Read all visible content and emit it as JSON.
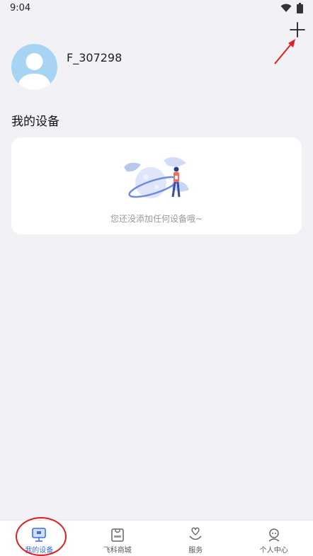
{
  "status_bar": {
    "time": "9:04"
  },
  "header": {
    "username": "F_307298",
    "add_icon": "plus-icon"
  },
  "devices": {
    "section_title": "我的设备",
    "empty_message": "您还没添加任何设备哦~"
  },
  "bottom_nav": {
    "items": [
      {
        "label": "我的设备",
        "icon": "monitor-icon",
        "active": true
      },
      {
        "label": "飞科商城",
        "icon": "shopping-bag-icon",
        "active": false
      },
      {
        "label": "服务",
        "icon": "heart-hand-icon",
        "active": false
      },
      {
        "label": "个人中心",
        "icon": "profile-icon",
        "active": false
      }
    ]
  },
  "colors": {
    "background": "#f2f1f6",
    "card": "#ffffff",
    "accent": "#3b6fe0",
    "avatar": "#a7d4f3",
    "annotation": "#e02020"
  }
}
